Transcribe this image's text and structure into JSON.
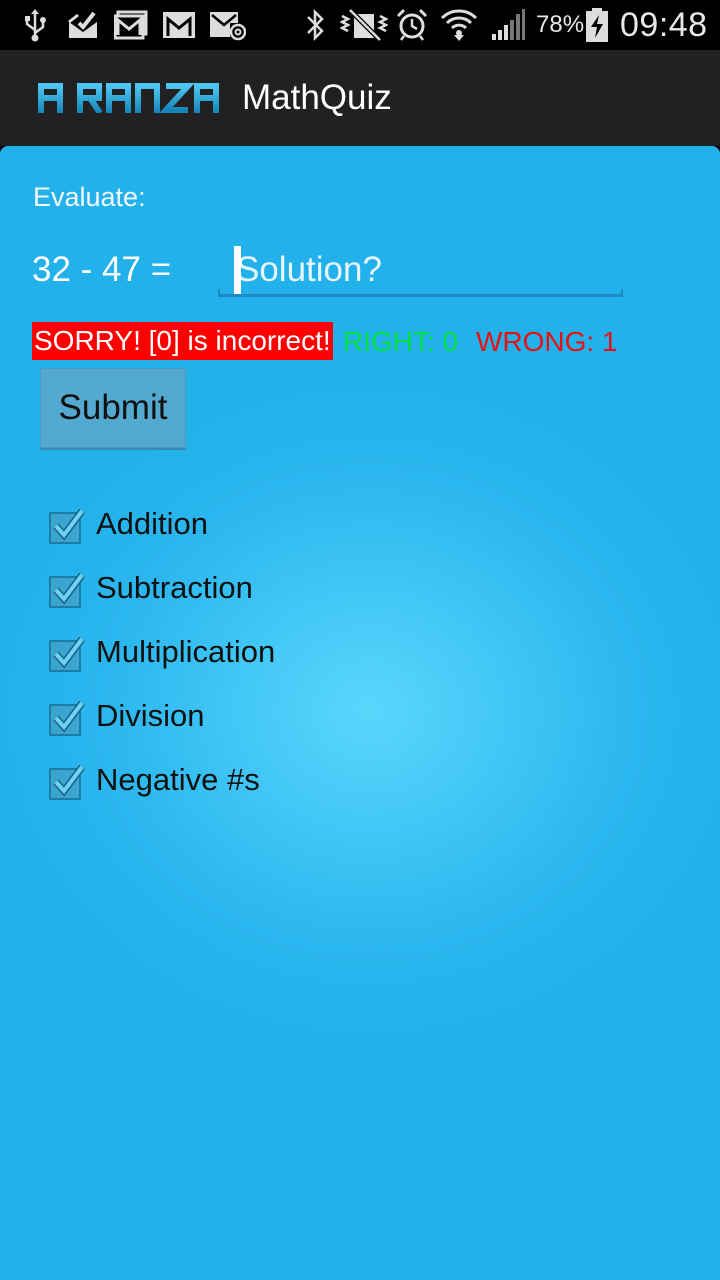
{
  "status_bar": {
    "battery_percent": "78%",
    "time": "09:48",
    "icons": [
      "usb-icon",
      "task-check-icon",
      "gallery-mail-icon",
      "gmail-icon",
      "email-at-icon",
      "bluetooth-icon",
      "vibrate-mute-icon",
      "alarm-icon",
      "wifi-icon",
      "signal-icon",
      "battery-charging-icon"
    ]
  },
  "action_bar": {
    "logo_text": "AIRANZA",
    "title": "MathQuiz"
  },
  "quiz": {
    "evaluate_label": "Evaluate:",
    "equation": "32 - 47 =",
    "solution_placeholder": "Solution?",
    "feedback": "SORRY! [0] is incorrect!",
    "right_count": "RIGHT: 0",
    "wrong_count": "WRONG: 1",
    "submit_label": "Submit"
  },
  "options": [
    {
      "label": "Addition",
      "checked": true
    },
    {
      "label": "Subtraction",
      "checked": true
    },
    {
      "label": "Multiplication",
      "checked": true
    },
    {
      "label": "Division",
      "checked": true
    },
    {
      "label": "Negative #s",
      "checked": true
    }
  ],
  "colors": {
    "content_bg": "#22b1ea",
    "content_glow": "#5ad6fc",
    "action_bar": "#212121",
    "feedback_bg": "#ff0000",
    "right_color": "#00e040",
    "wrong_color": "#e81010",
    "logo": "#1e9fd6"
  }
}
